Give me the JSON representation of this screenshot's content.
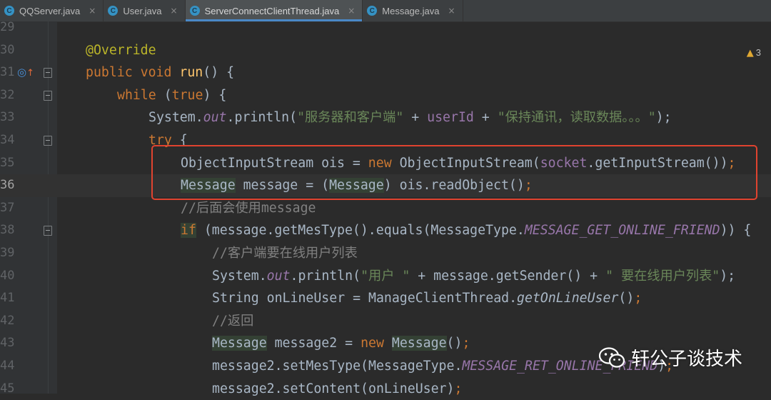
{
  "tabs": [
    {
      "icon_letter": "C",
      "label": "QQServer.java",
      "close": "×"
    },
    {
      "icon_letter": "C",
      "label": "User.java",
      "close": "×"
    },
    {
      "icon_letter": "C",
      "label": "ServerConnectClientThread.java",
      "close": "×",
      "active": true
    },
    {
      "icon_letter": "C",
      "label": "Message.java",
      "close": "×"
    }
  ],
  "warnings": {
    "icon": "warning-triangle-icon",
    "count": "3"
  },
  "gutter_icons": {
    "line_31": "override-method-icon"
  },
  "lines": [
    {
      "n": "29"
    },
    {
      "n": "30",
      "t1": "@Override"
    },
    {
      "n": "31",
      "t1": "public void ",
      "t2": "run",
      "t3": "() {"
    },
    {
      "n": "32",
      "t1": "while ",
      "t2": "(",
      "t3": "true",
      "t4": ") {"
    },
    {
      "n": "33",
      "t1": "System.",
      "t2": "out",
      "t3": ".println(",
      "t4": "\"服务器和客户端\"",
      "t5": " + ",
      "t6": "userId",
      "t7": " + ",
      "t8": "\"保持通讯，读取数据。。。\"",
      "t9": ");"
    },
    {
      "n": "34",
      "t1": "try",
      "t2": " {"
    },
    {
      "n": "35",
      "t1": "ObjectInputStream ois = ",
      "t2": "new ",
      "t3": "ObjectInputStream(",
      "t4": "socket",
      "t5": ".getInputStream())",
      "t6": ";"
    },
    {
      "n": "36",
      "t1": "Message",
      "t2": " message = (",
      "t3": "Message",
      "t4": ") ois.readObject()",
      "t5": ";"
    },
    {
      "n": "37",
      "t1": "//后面会使用message"
    },
    {
      "n": "38",
      "t1": "if",
      "t2": " (message.getMesType().equals(MessageType.",
      "t3": "MESSAGE_GET_ONLINE_FRIEND",
      "t4": ")) {"
    },
    {
      "n": "39",
      "t1": "//客户端要在线用户列表"
    },
    {
      "n": "40",
      "t1": "System.",
      "t2": "out",
      "t3": ".println(",
      "t4": "\"用户 \"",
      "t5": " + message.getSender() + ",
      "t6": "\" 要在线用户列表\"",
      "t7": ");"
    },
    {
      "n": "41",
      "t1": "String onLineUser = ManageClientThread.",
      "t2": "getOnLineUser",
      "t3": "()",
      "t4": ";"
    },
    {
      "n": "42",
      "t1": "//返回"
    },
    {
      "n": "43",
      "t1": "Message",
      "t2": " message2 = ",
      "t3": "new ",
      "t4": "Message",
      "t5": "()",
      "t6": ";"
    },
    {
      "n": "44",
      "t1": "message2.setMesType(MessageType.",
      "t2": "MESSAGE_RET_ONLINE_FRIEND",
      "t3": ")",
      "t4": ";"
    },
    {
      "n": "45",
      "t1": "message2.setContent(onLineUser)",
      "t2": ";"
    }
  ],
  "watermark": {
    "icon": "wechat-icon",
    "text": "轩公子谈技术"
  },
  "colors": {
    "keyword": "#cc7832",
    "string": "#6a8759",
    "field": "#9876aa",
    "function": "#ffc66d",
    "annotation": "#bbb529",
    "comment": "#808080",
    "highlight_box": "#e0432f"
  }
}
